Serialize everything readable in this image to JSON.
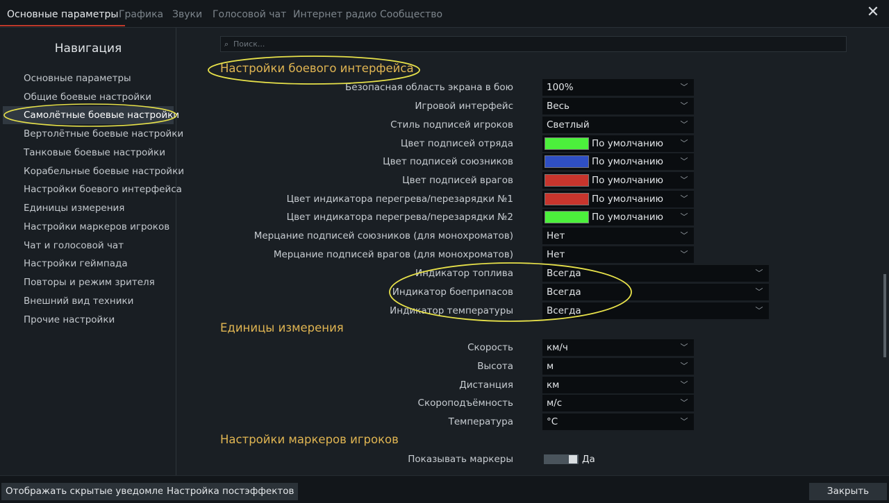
{
  "tabs": [
    {
      "label": "Основные параметры",
      "active": true
    },
    {
      "label": "Графика"
    },
    {
      "label": "Звуки"
    },
    {
      "label": "Голосовой чат"
    },
    {
      "label": "Интернет радио"
    },
    {
      "label": "Сообщество"
    }
  ],
  "close_glyph": "✕",
  "nav": {
    "title": "Навигация",
    "items": [
      "Основные параметры",
      "Общие боевые настройки",
      "Самолётные боевые настройки",
      "Вертолётные боевые настройки",
      "Танковые боевые настройки",
      "Корабельные боевые настройки",
      "Настройки боевого интерфейса",
      "Единицы измерения",
      "Настройки маркеров игроков",
      "Чат и голосовой чат",
      "Настройки геймпада",
      "Повторы и режим зрителя",
      "Внешний вид техники",
      "Прочие настройки"
    ],
    "selected_index": 2
  },
  "search": {
    "placeholder": "Поиск..."
  },
  "sections": {
    "interface": {
      "title": "Настройки боевого интерфейса",
      "rows": [
        {
          "label": "Безопасная область экрана в бою",
          "value": "100%"
        },
        {
          "label": "Игровой интерфейс",
          "value": "Весь"
        },
        {
          "label": "Стиль подписей игроков",
          "value": "Светлый"
        },
        {
          "label": "Цвет подписей отряда",
          "value": "По умолчанию",
          "swatch": "#4cf03c"
        },
        {
          "label": "Цвет подписей союзников",
          "value": "По умолчанию",
          "swatch": "#2f4fc4"
        },
        {
          "label": "Цвет подписей врагов",
          "value": "По умолчанию",
          "swatch": "#c8352d"
        },
        {
          "label": "Цвет индикатора перегрева/перезарядки №1",
          "value": "По умолчанию",
          "swatch": "#c8352d"
        },
        {
          "label": "Цвет индикатора перегрева/перезарядки №2",
          "value": "По умолчанию",
          "swatch": "#4cf03c"
        },
        {
          "label": "Мерцание подписей союзников (для монохроматов)",
          "value": "Нет"
        },
        {
          "label": "Мерцание подписей врагов (для монохроматов)",
          "value": "Нет"
        },
        {
          "label": "Индикатор топлива",
          "value": "Всегда",
          "wide": true
        },
        {
          "label": "Индикатор боеприпасов",
          "value": "Всегда",
          "wide": true
        },
        {
          "label": "Индикатор температуры",
          "value": "Всегда",
          "wide": true
        }
      ]
    },
    "units": {
      "title": "Единицы измерения",
      "rows": [
        {
          "label": "Скорость",
          "value": "км/ч"
        },
        {
          "label": "Высота",
          "value": "м"
        },
        {
          "label": "Дистанция",
          "value": "км"
        },
        {
          "label": "Скороподъёмность",
          "value": "м/с"
        },
        {
          "label": "Температура",
          "value": "°C"
        }
      ]
    },
    "markers": {
      "title": "Настройки маркеров игроков",
      "rows": [
        {
          "label": "Показывать маркеры",
          "value": "Да",
          "toggle": true
        }
      ]
    }
  },
  "bottom": {
    "show_hidden": "Отображать скрытые уведомления",
    "postfx": "Настройка постэффектов",
    "close": "Закрыть"
  },
  "colors": {
    "accent": "#e0b552",
    "annotation": "#e8e24a",
    "tab_underline": "#c0392b"
  }
}
